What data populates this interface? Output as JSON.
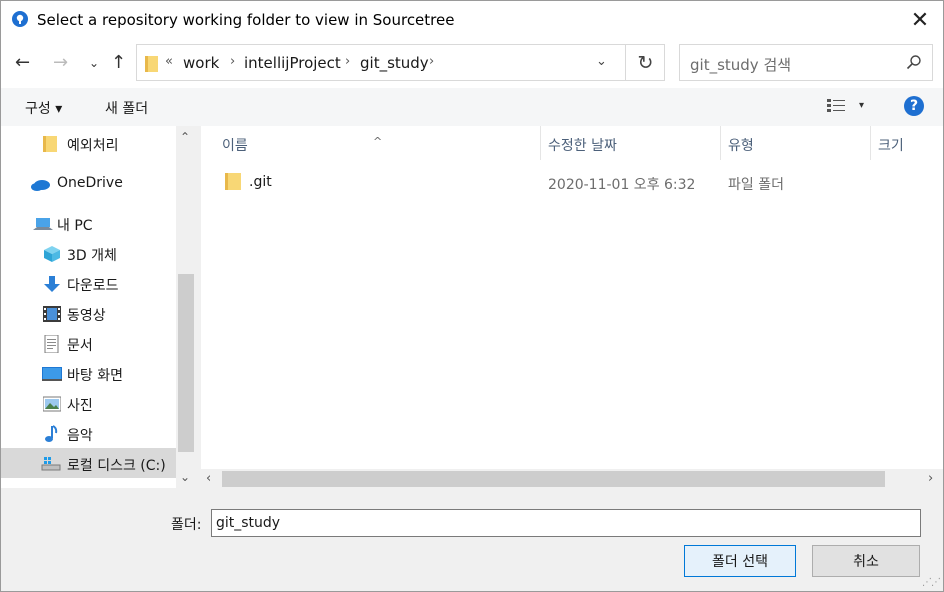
{
  "window": {
    "title": "Select a repository working folder to view in Sourcetree",
    "close_label": "✕"
  },
  "nav": {
    "back": "←",
    "forward": "→",
    "recent": "⌄",
    "up": "↑"
  },
  "address": {
    "overflow": "«",
    "crumbs": [
      "work",
      "intellijProject",
      "git_study"
    ],
    "separator": "›",
    "dropdown": "⌄",
    "refresh": "↻"
  },
  "search": {
    "placeholder": "git_study 검색"
  },
  "toolbar": {
    "organize_label": "구성 ▾",
    "new_folder_label": "새 폴더",
    "view_arrow": "▾",
    "help_label": "?"
  },
  "sidebar": {
    "items": [
      {
        "label": "예외처리",
        "icon": "folder-icon"
      },
      {
        "label": "OneDrive",
        "icon": "onedrive-icon"
      },
      {
        "label": "내 PC",
        "icon": "pc-icon"
      },
      {
        "label": "3D 개체",
        "icon": "3d-objects-icon"
      },
      {
        "label": "다운로드",
        "icon": "download-icon"
      },
      {
        "label": "동영상",
        "icon": "video-icon"
      },
      {
        "label": "문서",
        "icon": "document-icon"
      },
      {
        "label": "바탕 화면",
        "icon": "desktop-icon"
      },
      {
        "label": "사진",
        "icon": "picture-icon"
      },
      {
        "label": "음악",
        "icon": "music-icon"
      },
      {
        "label": "로컬 디스크 (C:)",
        "icon": "local-disk-icon"
      }
    ],
    "scroll_up": "⌃",
    "scroll_down": "⌄"
  },
  "columns": {
    "name": "이름",
    "date": "수정한 날짜",
    "type": "유형",
    "size": "크기",
    "sort_indicator": "^"
  },
  "files": [
    {
      "name": ".git",
      "date": "2020-11-01 오후 6:32",
      "type": "파일 폴더"
    }
  ],
  "hscroll": {
    "left": "‹",
    "right": "›"
  },
  "footer": {
    "folder_label": "폴더:",
    "folder_value": "git_study",
    "select_button": "폴더 선택",
    "cancel_button": "취소"
  },
  "colors": {
    "accent": "#0078d7",
    "help": "#1e6fd1",
    "folder": "#f8d775",
    "header_text": "#4c607a"
  }
}
